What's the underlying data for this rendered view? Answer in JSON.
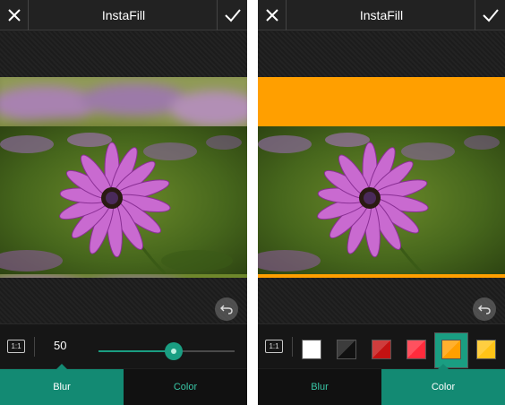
{
  "left": {
    "app_title": "InstaFill",
    "ratio_label": "1:1",
    "blur_value": "50",
    "blur_percent": 0.55,
    "tabs": {
      "blur": "Blur",
      "color": "Color"
    },
    "active_tab": "blur"
  },
  "right": {
    "app_title": "InstaFill",
    "ratio_label": "1:1",
    "tabs": {
      "blur": "Blur",
      "color": "Color"
    },
    "active_tab": "color",
    "fill_color": "#ff9f00",
    "swatches": [
      {
        "name": "white",
        "color": "#ffffff"
      },
      {
        "name": "black",
        "color": "#111111"
      },
      {
        "name": "dark-red",
        "color": "#c41212"
      },
      {
        "name": "red",
        "color": "#ff2b3c"
      },
      {
        "name": "orange",
        "color": "#ff9f00",
        "selected": true
      },
      {
        "name": "yellow",
        "color": "#ffc317"
      }
    ]
  },
  "colors": {
    "accent": "#1a9e82",
    "tab_active": "#138a73",
    "tab_inactive_text": "#39c6a6",
    "topbar": "#222222"
  },
  "icons": [
    "close-icon",
    "checkmark-icon",
    "undo-icon",
    "aspect-ratio-icon"
  ]
}
